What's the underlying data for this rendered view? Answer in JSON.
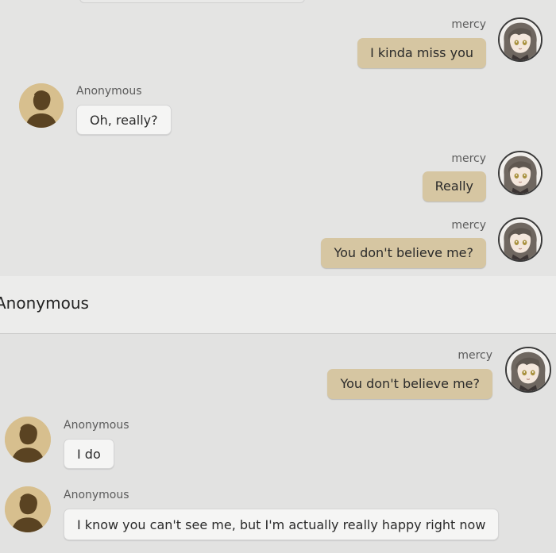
{
  "header": {
    "title": "Anonymous"
  },
  "messages_top": [
    {
      "sender": "mercy",
      "text": "I kinda miss you"
    },
    {
      "sender": "Anonymous",
      "text": "Oh, really?"
    },
    {
      "sender": "mercy",
      "text": "Really"
    },
    {
      "sender": "mercy",
      "text": "You don't believe me?"
    }
  ],
  "messages_bottom": [
    {
      "sender": "mercy",
      "text": "You don't believe me?"
    },
    {
      "sender": "Anonymous",
      "text": "I do"
    },
    {
      "sender": "Anonymous",
      "text": "I know you can't see me, but I'm actually really happy right now"
    }
  ],
  "icons": {
    "anonymous_avatar": "silhouette-avatar-icon",
    "mercy_avatar": "anime-girl-avatar-icon"
  },
  "colors": {
    "self_bubble": "#d6c6a2",
    "other_bubble": "#f5f5f4",
    "avatar_anon": "#d7bf8e",
    "background": "#e3e3e3"
  }
}
